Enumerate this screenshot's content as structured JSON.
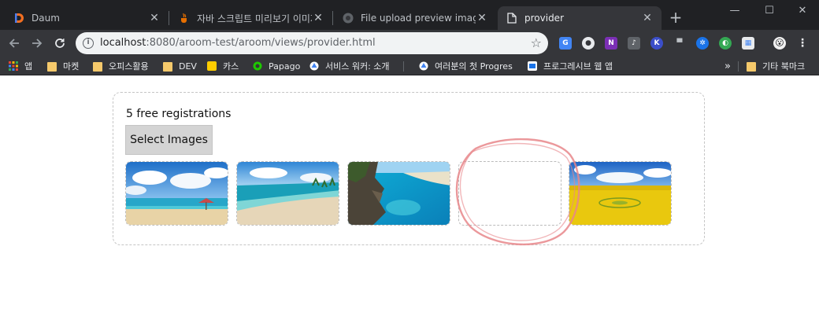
{
  "browser": {
    "tabs": [
      {
        "title": "Daum",
        "favicon": "daum-d-icon",
        "active": false
      },
      {
        "title": "자바 스크립트 미리보기 이미지",
        "favicon": "java-cup-icon",
        "active": false
      },
      {
        "title": "File upload preview image",
        "favicon": "github-octocat-icon",
        "active": false
      },
      {
        "title": "provider",
        "favicon": "page-icon",
        "active": true
      }
    ],
    "new_tab_label": "+",
    "address": {
      "host": "localhost",
      "rest": ":8080/aroom-test/aroom/views/provider.html"
    },
    "bookmarks": [
      {
        "label": "앱",
        "icon": "apps-grid-icon"
      },
      {
        "label": "마켓",
        "icon": "folder-icon"
      },
      {
        "label": "오피스활용",
        "icon": "folder-icon"
      },
      {
        "label": "DEV",
        "icon": "folder-icon"
      },
      {
        "label": "카스",
        "icon": "kakao-icon"
      },
      {
        "label": "Papago",
        "icon": "papago-icon"
      },
      {
        "label": "서비스 워커: 소개",
        "icon": "google-dev-icon"
      },
      {
        "label": "여러분의 첫 Progres",
        "icon": "google-dev-icon"
      },
      {
        "label": "프로그레시브 웹 앱",
        "icon": "pwa-icon"
      }
    ],
    "bookmarks_overflow": "»",
    "other_bookmarks": "기타 북마크",
    "profile_emoji": "😮"
  },
  "page": {
    "free_text": "5 free registrations",
    "select_button": "Select Images",
    "thumbnails": [
      {
        "scene": "beach-clouds-blue-sky",
        "empty": false
      },
      {
        "scene": "beach-shoreline-waves",
        "empty": false
      },
      {
        "scene": "rocky-coast-turquoise-water",
        "empty": false
      },
      {
        "scene": "empty-preview",
        "empty": true
      },
      {
        "scene": "yellow-field-blue-sky",
        "empty": false
      }
    ],
    "annotation_color": "#e8868a"
  }
}
